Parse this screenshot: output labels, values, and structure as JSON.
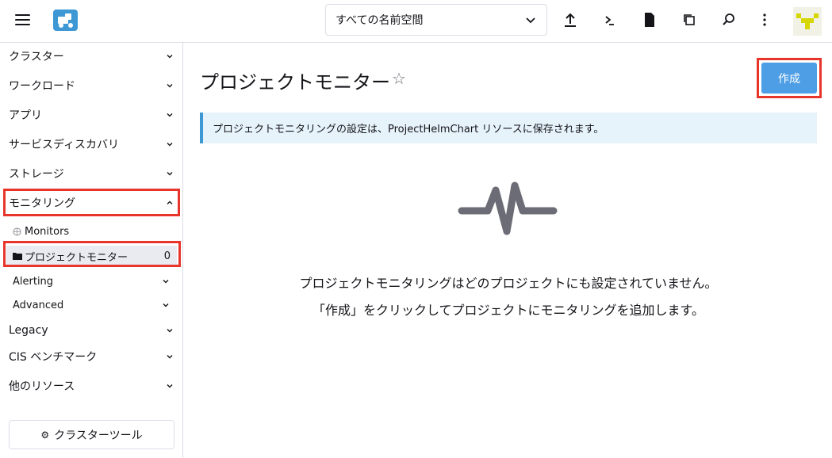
{
  "header": {
    "namespace_select": "すべての名前空間",
    "icons": [
      "hamburger-icon",
      "rancher-logo-icon",
      "upload-icon",
      "terminal-icon",
      "file-icon",
      "copy-icon",
      "search-icon",
      "more-vertical-icon"
    ]
  },
  "sidebar": {
    "groups": {
      "cluster": "クラスター",
      "workload": "ワークロード",
      "apps": "アプリ",
      "service_discovery": "サービスディスカバリ",
      "storage": "ストレージ",
      "monitoring": "モニタリング",
      "legacy": "Legacy",
      "cis": "CIS ベンチマーク",
      "other_resources": "他のリソース"
    },
    "sub": {
      "monitors": "Monitors",
      "project_monitor": "プロジェクトモニター",
      "project_monitor_count": "0",
      "alerting": "Alerting",
      "advanced": "Advanced"
    },
    "cluster_tools": "クラスターツール"
  },
  "main": {
    "title": "プロジェクトモニター",
    "create_label": "作成",
    "banner": "プロジェクトモニタリングの設定は、ProjectHelmChart リソースに保存されます。",
    "empty_line1": "プロジェクトモニタリングはどのプロジェクトにも設定されていません。",
    "empty_line2": "「作成」をクリックしてプロジェクトにモニタリングを追加します。"
  },
  "colors": {
    "accent": "#4e9ee5",
    "highlight": "#e8352c",
    "banner_bg": "#e7f3fb",
    "banner_border": "#3d98d3"
  }
}
